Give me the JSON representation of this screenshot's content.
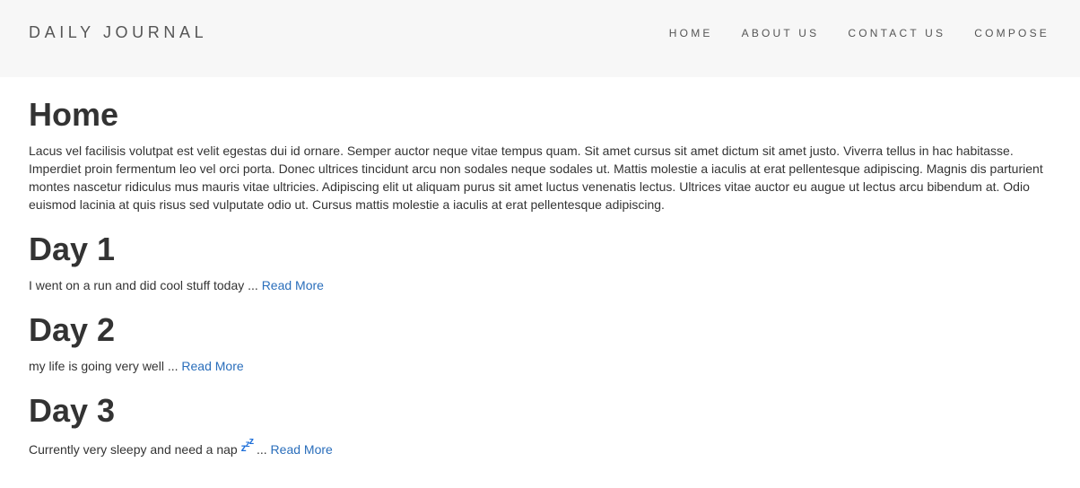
{
  "navbar": {
    "brand": "DAILY JOURNAL",
    "links": [
      "HOME",
      "ABOUT US",
      "CONTACT US",
      "COMPOSE"
    ]
  },
  "home": {
    "title": "Home",
    "intro": "Lacus vel facilisis volutpat est velit egestas dui id ornare. Semper auctor neque vitae tempus quam. Sit amet cursus sit amet dictum sit amet justo. Viverra tellus in hac habitasse. Imperdiet proin fermentum leo vel orci porta. Donec ultrices tincidunt arcu non sodales neque sodales ut. Mattis molestie a iaculis at erat pellentesque adipiscing. Magnis dis parturient montes nascetur ridiculus mus mauris vitae ultricies. Adipiscing elit ut aliquam purus sit amet luctus venenatis lectus. Ultrices vitae auctor eu augue ut lectus arcu bibendum at. Odio euismod lacinia at quis risus sed vulputate odio ut. Cursus mattis molestie a iaculis at erat pellentesque adipiscing."
  },
  "posts": [
    {
      "title": "Day 1",
      "excerpt": "I went on a run and did cool stuff today ...",
      "read_more": "Read More"
    },
    {
      "title": "Day 2",
      "excerpt": "my life is going very well ...",
      "read_more": "Read More"
    },
    {
      "title": "Day 3",
      "excerpt_before": "Currently very sleepy and need a nap",
      "emoji": "zzz",
      "excerpt_after": "...",
      "read_more": "Read More"
    }
  ],
  "colors": {
    "navbar_bg": "#f7f7f7",
    "link": "#2a6ebb",
    "text": "#333333"
  }
}
